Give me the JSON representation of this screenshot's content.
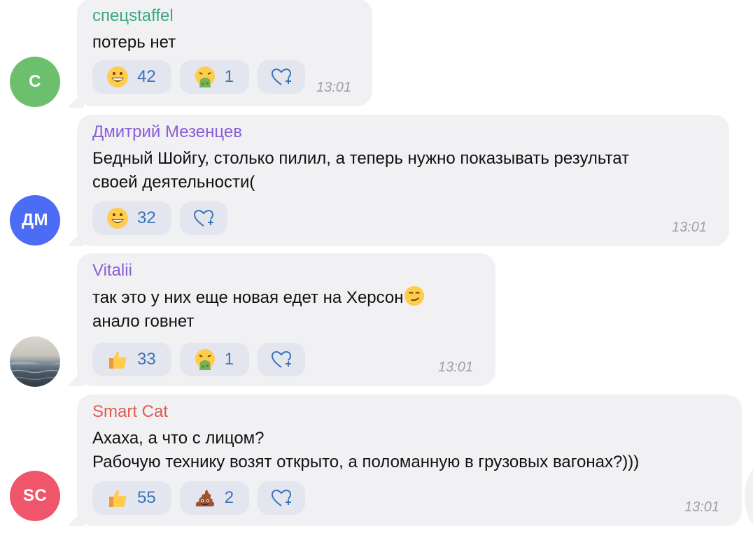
{
  "messages": [
    {
      "name": "спецstaffel",
      "name_color": "#3aa881",
      "avatar_initials": "С",
      "avatar_color": "#6cc06d",
      "lines": [
        "потерь нет"
      ],
      "reactions": [
        {
          "emoji": "grinning-face-icon",
          "count": "42"
        },
        {
          "emoji": "vomiting-face-icon",
          "count": "1"
        }
      ],
      "time": "13:01"
    },
    {
      "name": "Дмитрий Мезенцев",
      "name_color": "#8a5ed6",
      "avatar_initials": "ДМ",
      "avatar_color": "#4d6cf5",
      "lines": [
        "Бедный Шойгу, столько пилил, а теперь нужно показывать результат",
        "своей деятельности("
      ],
      "reactions": [
        {
          "emoji": "grinning-face-icon",
          "count": "32"
        }
      ],
      "time": "13:01"
    },
    {
      "name": "Vitalii",
      "name_color": "#8a5ed6",
      "avatar_initials": "",
      "avatar_color": "#7a8e9b",
      "lines": [
        "так это у них еще новая едет на Херсон",
        "анало говнет"
      ],
      "inline_emoji": "smirking-face-icon",
      "reactions": [
        {
          "emoji": "thumbs-up-icon",
          "count": "33"
        },
        {
          "emoji": "vomiting-face-icon",
          "count": "1"
        }
      ],
      "time": "13:01"
    },
    {
      "name": "Smart Cat",
      "name_color": "#e15b4d",
      "avatar_initials": "SC",
      "avatar_color": "#f0566b",
      "lines": [
        "Ахаха, а что с лицом?",
        "Рабочую технику возят открыто, а поломанную в грузовых вагонах?)))"
      ],
      "reactions": [
        {
          "emoji": "thumbs-up-icon",
          "count": "55"
        },
        {
          "emoji": "pile-of-poo-icon",
          "count": "2"
        }
      ],
      "time": "13:01"
    }
  ],
  "add_reaction_icon": "heart-plus-icon"
}
